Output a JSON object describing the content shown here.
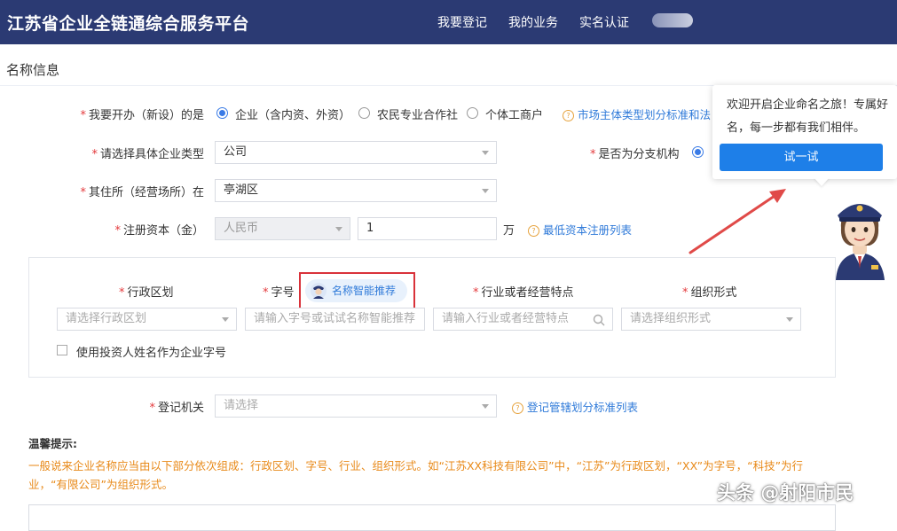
{
  "header": {
    "title": "江苏省企业全链通综合服务平台",
    "nav": [
      "我要登记",
      "我的业务",
      "实名认证"
    ]
  },
  "section_title": "名称信息",
  "form": {
    "type_label": "我要开办（新设）的是",
    "type_options": [
      "企业（含内资、外资）",
      "农民专业合作社",
      "个体工商户"
    ],
    "type_selected": "企业（含内资、外资）",
    "type_link": "市场主体类型划分标准和法",
    "company_type_label": "请选择具体企业类型",
    "company_type_value": "公司",
    "branch_label": "是否为分支机构",
    "residence_label": "其住所（经营场所）在",
    "residence_value": "亭湖区",
    "capital_label": "注册资本（金）",
    "currency_value": "人民币",
    "capital_value": "1",
    "capital_unit": "万",
    "capital_link": "最低资本注册列表"
  },
  "name_panel": {
    "cols": {
      "division": "行政区划",
      "zihao": "字号",
      "industry": "行业或者经营特点",
      "org": "组织形式"
    },
    "smart_button": "名称智能推荐",
    "placeholders": {
      "division": "请选择行政区划",
      "zihao": "请输入字号或试试名称智能推荐",
      "industry": "请输入行业或者经营特点",
      "org": "请选择组织形式"
    },
    "checkbox_label": "使用投资人姓名作为企业字号"
  },
  "registry": {
    "label": "登记机关",
    "placeholder": "请选择",
    "link": "登记管辖划分标准列表"
  },
  "tips": {
    "title": "温馨提示:",
    "text": "一般说来企业名称应当由以下部分依次组成：行政区划、字号、行业、组织形式。如“江苏XX科技有限公司”中，“江苏”为行政区划，“XX”为字号，“科技”为行业，“有限公司”为组织形式。"
  },
  "popup": {
    "text": "欢迎开启企业命名之旅！专属好名，每一步都有我们相伴。",
    "button": "试一试"
  },
  "watermark": "头条 @射阳市民",
  "colors": {
    "header_bg": "#2b3a73",
    "accent": "#2f7ad9",
    "required": "#e4393c",
    "tip_text": "#e88a1a",
    "highlight_border": "#d9323a",
    "arrow": "#e04a48"
  }
}
